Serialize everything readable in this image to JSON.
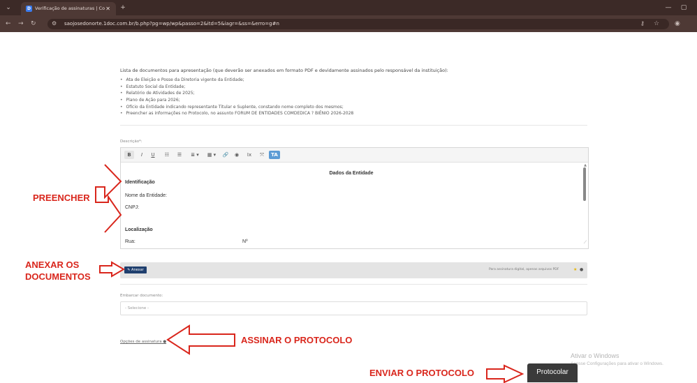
{
  "browser": {
    "tab_title": "Verificação de assinaturas | Co",
    "tab_favicon": "D",
    "url": "saojosedonorte.1doc.com.br/b.php?pg=wp/wp&passo=2&itd=5&iagr=&ss=&erro=g#n",
    "new_tab": "+",
    "close_tab": "✕",
    "minimize": "—",
    "maximize": "▢"
  },
  "documents": {
    "intro": "Lista de documentos para apresentação (que deverão ser anexados em formato PDF e devidamente assinados pelo responsável da instituição):",
    "items": [
      "Ata de Eleição e Posse da Diretoria vigente da Entidade;",
      "Estatuto Social da Entidade;",
      "Relatório de Atividades de 2025;",
      "Plano de Ação para 2026;",
      "Ofício da Entidade indicando representante Titular e Suplente, constando nome completo dos mesmos;",
      "Preencher as informações no Protocolo, no assunto FORUM DE ENTIDADES COMDEDICA ? BIÊNIO 2026-2028"
    ]
  },
  "editor": {
    "label": "Descrição*:",
    "toolbar": [
      "B",
      "I",
      "U",
      "☷",
      "☰",
      "≣ ▾",
      "▦ ▾",
      "🔗",
      "◉",
      "Ix",
      "⤧",
      "TA"
    ],
    "heading": "Dados da Entidade",
    "section1": "Identificação",
    "field_nome": "Nome da Entidade:",
    "field_cnpj": "CNPJ:",
    "section2": "Localização",
    "field_rua": "Rua:",
    "field_num": "Nº"
  },
  "attach": {
    "button": "✎ Anexar",
    "hint": "Para assinatura digital, apenas arquivos PDF"
  },
  "embed": {
    "label": "Embarcar documento:",
    "placeholder": "- Selecione -"
  },
  "options_link": "Opções de assinatura",
  "annotations": {
    "preencher": "PREENCHER",
    "anexar_line1": "ANEXAR OS",
    "anexar_line2": "DOCUMENTOS",
    "assinar": "ASSINAR O PROTOCOLO",
    "enviar": "ENVIAR O PROTOCOLO"
  },
  "watermark": {
    "line1": "Ativar o Windows",
    "line2": "Acesse Configurações para ativar o Windows."
  },
  "submit_button": "Protocolar",
  "colors": {
    "annotation_red": "#d9261c",
    "attach_button": "#1f3f6e",
    "chrome_bar": "#3c2a27"
  }
}
